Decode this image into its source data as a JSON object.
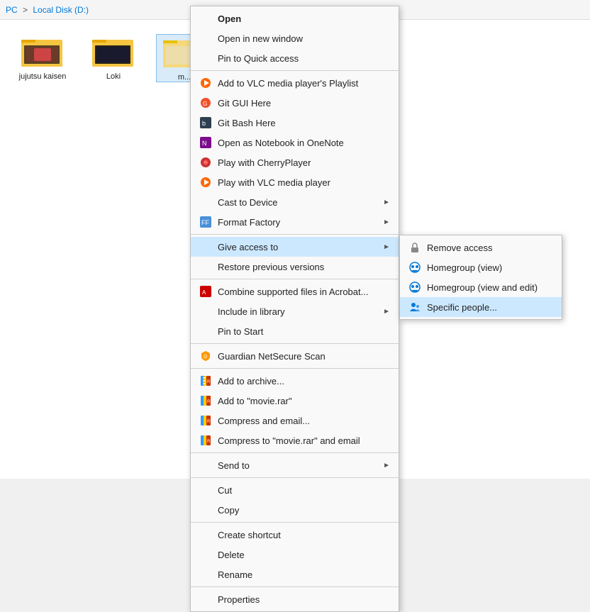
{
  "breadcrumb": {
    "parts": [
      "PC",
      "Local Disk (D:)"
    ],
    "separator": ">"
  },
  "folders": [
    {
      "name": "jujutsu kaisen",
      "selected": false
    },
    {
      "name": "Loki",
      "selected": false
    },
    {
      "name": "m...",
      "selected": true
    }
  ],
  "context_menu": {
    "items": [
      {
        "id": "open",
        "label": "Open",
        "icon": "",
        "bold": true,
        "separator_after": false,
        "has_submenu": false
      },
      {
        "id": "open-new-window",
        "label": "Open in new window",
        "icon": "",
        "bold": false,
        "separator_after": false,
        "has_submenu": false
      },
      {
        "id": "pin-quick",
        "label": "Pin to Quick access",
        "icon": "",
        "bold": false,
        "separator_after": false,
        "has_submenu": false
      },
      {
        "id": "add-vlc-playlist",
        "label": "Add to VLC media player's Playlist",
        "icon": "vlc",
        "bold": false,
        "separator_after": false,
        "has_submenu": false
      },
      {
        "id": "git-gui",
        "label": "Git GUI Here",
        "icon": "git-gui",
        "bold": false,
        "separator_after": false,
        "has_submenu": false
      },
      {
        "id": "git-bash",
        "label": "Git Bash Here",
        "icon": "git-bash",
        "bold": false,
        "separator_after": false,
        "has_submenu": false
      },
      {
        "id": "onenote",
        "label": "Open as Notebook in OneNote",
        "icon": "onenote",
        "bold": false,
        "separator_after": false,
        "has_submenu": false
      },
      {
        "id": "cherry",
        "label": "Play with CherryPlayer",
        "icon": "cherry",
        "bold": false,
        "separator_after": false,
        "has_submenu": false
      },
      {
        "id": "vlc",
        "label": "Play with VLC media player",
        "icon": "vlc2",
        "bold": false,
        "separator_after": false,
        "has_submenu": false
      },
      {
        "id": "cast",
        "label": "Cast to Device",
        "icon": "",
        "bold": false,
        "separator_after": false,
        "has_submenu": true
      },
      {
        "id": "format-factory",
        "label": "Format Factory",
        "icon": "format",
        "bold": false,
        "separator_after": true,
        "has_submenu": true
      },
      {
        "id": "give-access",
        "label": "Give access to",
        "icon": "",
        "bold": false,
        "separator_after": false,
        "has_submenu": true,
        "highlighted": true
      },
      {
        "id": "restore",
        "label": "Restore previous versions",
        "icon": "",
        "bold": false,
        "separator_after": true,
        "has_submenu": false
      },
      {
        "id": "acrobat",
        "label": "Combine supported files in Acrobat...",
        "icon": "acrobat",
        "bold": false,
        "separator_after": false,
        "has_submenu": false
      },
      {
        "id": "include-library",
        "label": "Include in library",
        "icon": "",
        "bold": false,
        "separator_after": false,
        "has_submenu": true
      },
      {
        "id": "pin-start",
        "label": "Pin to Start",
        "icon": "",
        "bold": false,
        "separator_after": true,
        "has_submenu": false
      },
      {
        "id": "guardian",
        "label": "Guardian NetSecure Scan",
        "icon": "guardian",
        "bold": false,
        "separator_after": true,
        "has_submenu": false
      },
      {
        "id": "add-archive",
        "label": "Add to archive...",
        "icon": "rar",
        "bold": false,
        "separator_after": false,
        "has_submenu": false
      },
      {
        "id": "add-movie-rar",
        "label": "Add to \"movie.rar\"",
        "icon": "rar2",
        "bold": false,
        "separator_after": false,
        "has_submenu": false
      },
      {
        "id": "compress-email",
        "label": "Compress and email...",
        "icon": "rar3",
        "bold": false,
        "separator_after": false,
        "has_submenu": false
      },
      {
        "id": "compress-movie-email",
        "label": "Compress to \"movie.rar\" and email",
        "icon": "rar4",
        "bold": false,
        "separator_after": true,
        "has_submenu": false
      },
      {
        "id": "send-to",
        "label": "Send to",
        "icon": "",
        "bold": false,
        "separator_after": true,
        "has_submenu": true
      },
      {
        "id": "cut",
        "label": "Cut",
        "icon": "",
        "bold": false,
        "separator_after": false,
        "has_submenu": false
      },
      {
        "id": "copy",
        "label": "Copy",
        "icon": "",
        "bold": false,
        "separator_after": true,
        "has_submenu": false
      },
      {
        "id": "create-shortcut",
        "label": "Create shortcut",
        "icon": "",
        "bold": false,
        "separator_after": false,
        "has_submenu": false
      },
      {
        "id": "delete",
        "label": "Delete",
        "icon": "",
        "bold": false,
        "separator_after": false,
        "has_submenu": false
      },
      {
        "id": "rename",
        "label": "Rename",
        "icon": "",
        "bold": false,
        "separator_after": true,
        "has_submenu": false
      },
      {
        "id": "properties",
        "label": "Properties",
        "icon": "",
        "bold": false,
        "separator_after": false,
        "has_submenu": false
      }
    ],
    "submenu_give_access": {
      "items": [
        {
          "id": "remove-access",
          "label": "Remove access",
          "icon": "lock"
        },
        {
          "id": "homegroup-view",
          "label": "Homegroup (view)",
          "icon": "homegroup"
        },
        {
          "id": "homegroup-view-edit",
          "label": "Homegroup (view and edit)",
          "icon": "homegroup2"
        },
        {
          "id": "specific-people",
          "label": "Specific people...",
          "icon": "people",
          "highlighted": true
        }
      ]
    }
  }
}
